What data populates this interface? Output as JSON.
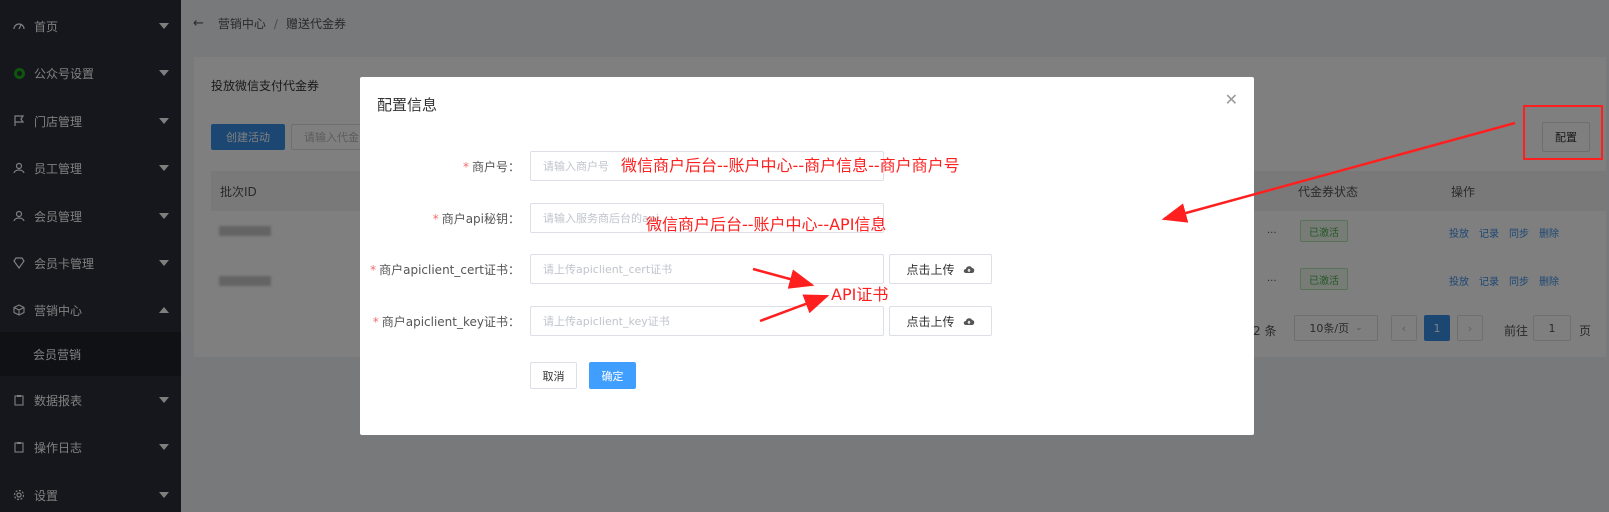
{
  "sidebar": {
    "items": [
      {
        "label": "首页",
        "icon": "dashboard-icon"
      },
      {
        "label": "公众号设置",
        "icon": "wechat-circle-icon"
      },
      {
        "label": "门店管理",
        "icon": "flag-icon"
      },
      {
        "label": "员工管理",
        "icon": "user-icon"
      },
      {
        "label": "会员管理",
        "icon": "user-icon"
      },
      {
        "label": "会员卡管理",
        "icon": "diamond-icon"
      },
      {
        "label": "营销中心",
        "icon": "cube-icon"
      },
      {
        "label": "数据报表",
        "icon": "clipboard-icon"
      },
      {
        "label": "操作日志",
        "icon": "clipboard-icon"
      },
      {
        "label": "设置",
        "icon": "gear-icon"
      }
    ],
    "submenu_label": "会员营销"
  },
  "breadcrumb": {
    "parent": "营销中心",
    "separator": "/",
    "current": "赠送代金券"
  },
  "card": {
    "title": "投放微信支付代金券",
    "create_button": "创建活动",
    "search_placeholder": "请输入代金",
    "config_button": "配置",
    "columns": {
      "batch_id": "批次ID",
      "status": "代金券状态",
      "ops": "操作"
    },
    "rows": [
      {
        "status": "已激活",
        "ops": [
          "投放",
          "记录",
          "同步",
          "删除"
        ],
        "ellipsis": "..."
      },
      {
        "status": "已激活",
        "ops": [
          "投放",
          "记录",
          "同步",
          "删除"
        ],
        "ellipsis": "..."
      }
    ],
    "pager": {
      "total": "2 条",
      "page_size": "10条/页",
      "current": "1",
      "goto_prefix": "前往",
      "goto_value": "1",
      "goto_suffix": "页"
    }
  },
  "modal": {
    "title": "配置信息",
    "fields": [
      {
        "label": "商户号：",
        "placeholder": "请输入商户号"
      },
      {
        "label": "商户api秘钥：",
        "placeholder": "请输入服务商后台的api"
      },
      {
        "label": "商户apiclient_cert证书：",
        "placeholder": "请上传apiclient_cert证书",
        "upload": "点击上传"
      },
      {
        "label": "商户apiclient_key证书：",
        "placeholder": "请上传apiclient_key证书",
        "upload": "点击上传"
      }
    ],
    "cancel": "取消",
    "confirm": "确定"
  },
  "annotations": {
    "merchant_id_hint": "微信商户后台--账户中心--商户信息--商户商户号",
    "api_key_hint": "微信商户后台--账户中心--API信息",
    "cert_hint": "API证书",
    "color": "#ff1f1f"
  }
}
